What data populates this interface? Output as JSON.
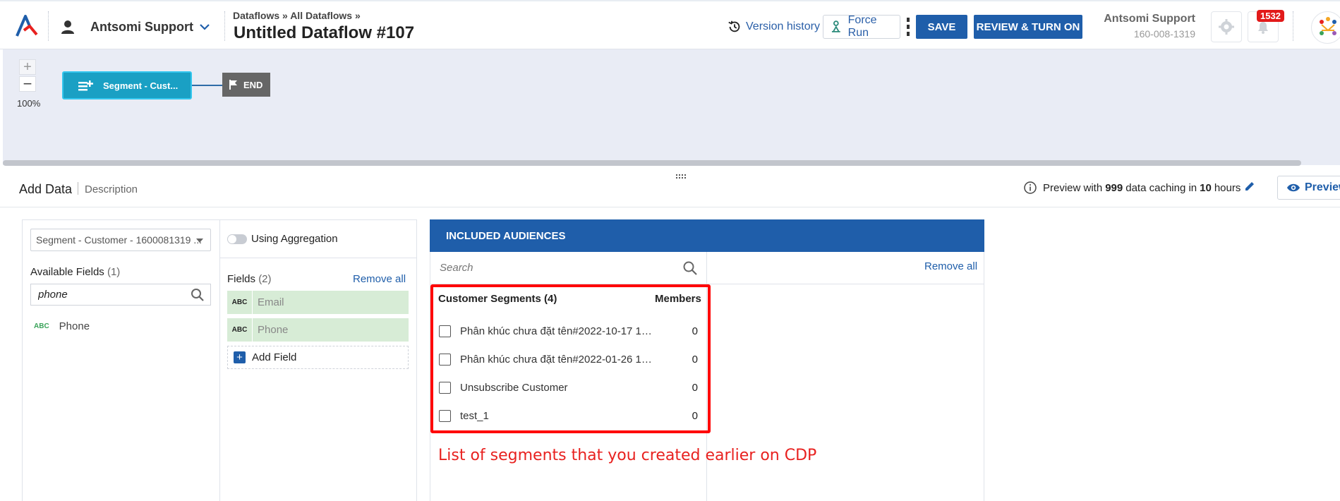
{
  "header": {
    "account_name": "Antsomi Support",
    "breadcrumb": {
      "root": "Dataflows",
      "sep": "»",
      "current": "All Dataflows",
      "tail": "»"
    },
    "title": "Untitled Dataflow #107",
    "version_history_label": "Version history",
    "force_run_label": "Force Run",
    "save_label": "SAVE",
    "review_label": "REVIEW & TURN ON",
    "user_name": "Antsomi Support",
    "user_id": "160-008-1319",
    "notification_count": "1532"
  },
  "canvas": {
    "zoom_in": "+",
    "zoom_out": "−",
    "zoom_level": "100%",
    "source_node_label": "Segment - Cust...",
    "end_node_label": "END"
  },
  "tabs": {
    "add_data": "Add Data",
    "description": "Description"
  },
  "preview": {
    "prefix": "Preview with",
    "count": "999",
    "middle": "data caching in",
    "hours": "10",
    "suffix": "hours",
    "button_label": "Preview"
  },
  "source": {
    "selected": "Segment - Customer - 1600081319 ...",
    "available_title": "Available Fields",
    "available_count": "(1)",
    "search_value": "phone",
    "available_fields": [
      {
        "type": "ABC",
        "label": "Phone"
      }
    ]
  },
  "aggregation": {
    "label": "Using Aggregation",
    "enabled": false
  },
  "fields": {
    "title": "Fields",
    "count": "(2)",
    "remove_all": "Remove all",
    "items": [
      {
        "type": "ABC",
        "label": "Email"
      },
      {
        "type": "ABC",
        "label": "Phone"
      }
    ],
    "add_field": "Add Field"
  },
  "audiences": {
    "header": "INCLUDED AUDIENCES",
    "search_placeholder": "Search",
    "remove_all": "Remove all",
    "segments_title": "Customer Segments (4)",
    "members_title": "Members",
    "segments": [
      {
        "name": "Phân khúc chưa đặt tên#2022-10-17 18:...",
        "members": "0"
      },
      {
        "name": "Phân khúc chưa đặt tên#2022-01-26 16:...",
        "members": "0"
      },
      {
        "name": "Unsubscribe Customer",
        "members": "0"
      },
      {
        "name": "test_1",
        "members": "0"
      }
    ]
  },
  "annotation": {
    "note": "List of segments that you created earlier on CDP",
    "color": "#ff0000"
  },
  "colors": {
    "brand_blue": "#1f5eaa",
    "node_teal": "#1aa0c4",
    "field_green": "#d7ecd6"
  }
}
